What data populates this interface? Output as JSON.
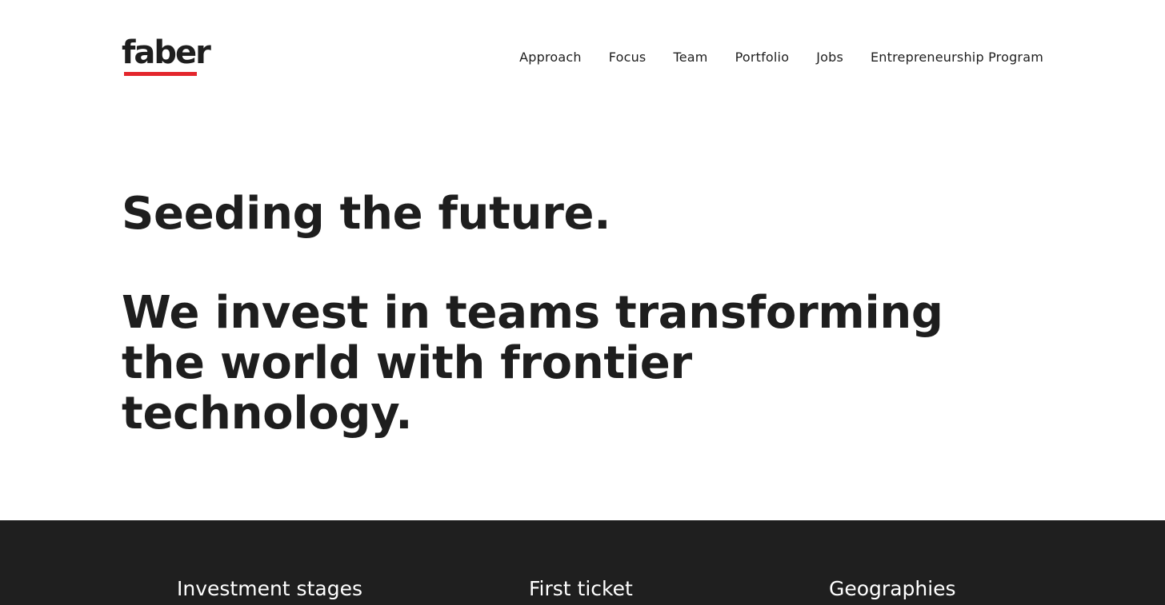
{
  "header": {
    "logo_text": "faber",
    "brand_color": "#e3262c",
    "nav": [
      {
        "label": "Approach"
      },
      {
        "label": "Focus"
      },
      {
        "label": "Team"
      },
      {
        "label": "Portfolio"
      },
      {
        "label": "Jobs"
      },
      {
        "label": "Entrepreneurship Program"
      }
    ]
  },
  "hero": {
    "headline": "Seeding the future.",
    "subheadline": "We invest in teams transforming the world with frontier technology."
  },
  "stats": {
    "background_color": "#1f1f1f",
    "headings": [
      {
        "label": "Investment stages"
      },
      {
        "label": "First ticket"
      },
      {
        "label": "Geographies"
      }
    ]
  }
}
